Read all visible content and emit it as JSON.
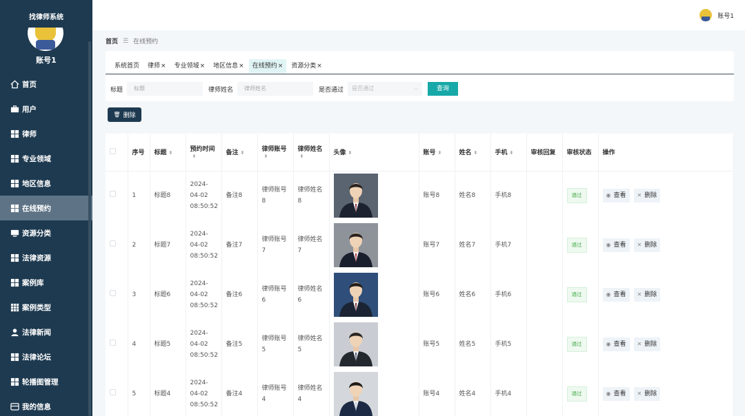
{
  "app": {
    "title": "找律师系统"
  },
  "sidebar": {
    "user": "账号1",
    "items": [
      {
        "label": "首页",
        "icon": "home-icon",
        "active": false
      },
      {
        "label": "用户",
        "icon": "briefcase-icon",
        "active": false
      },
      {
        "label": "律师",
        "icon": "grid-icon",
        "active": false
      },
      {
        "label": "专业领域",
        "icon": "grid-icon",
        "active": false
      },
      {
        "label": "地区信息",
        "icon": "grid-icon",
        "active": false
      },
      {
        "label": "在线预约",
        "icon": "grid-icon",
        "active": true
      },
      {
        "label": "资源分类",
        "icon": "monitor-icon",
        "active": false
      },
      {
        "label": "法律资源",
        "icon": "grid-icon",
        "active": false
      },
      {
        "label": "案例库",
        "icon": "grid-icon",
        "active": false
      },
      {
        "label": "案例类型",
        "icon": "table-icon",
        "active": false
      },
      {
        "label": "法律新闻",
        "icon": "user-icon",
        "active": false
      },
      {
        "label": "法律论坛",
        "icon": "grid-icon",
        "active": false
      },
      {
        "label": "轮播图管理",
        "icon": "grid-icon",
        "active": false
      },
      {
        "label": "我的信息",
        "icon": "card-icon",
        "active": false
      }
    ]
  },
  "header": {
    "user": "账号1"
  },
  "breadcrumb": {
    "home": "首页",
    "separator": "☰",
    "current": "在线预约"
  },
  "tabs": [
    {
      "label": "系统首页",
      "closable": false,
      "active": false
    },
    {
      "label": "律师",
      "closable": true,
      "active": false
    },
    {
      "label": "专业领域",
      "closable": true,
      "active": false
    },
    {
      "label": "地区信息",
      "closable": true,
      "active": false
    },
    {
      "label": "在线预约",
      "closable": true,
      "active": true
    },
    {
      "label": "资源分类",
      "closable": true,
      "active": false
    }
  ],
  "search": {
    "title_label": "标题",
    "title_placeholder": "标题",
    "lawyer_label": "律师姓名",
    "lawyer_placeholder": "律师姓名",
    "passed_label": "是否通过",
    "passed_placeholder": "是否通过",
    "query_button": "查询"
  },
  "toolbar": {
    "delete_label": "删除"
  },
  "table": {
    "columns": [
      "序号",
      "标题",
      "预约时间",
      "备注",
      "律师账号",
      "律师姓名",
      "头像",
      "账号",
      "姓名",
      "手机",
      "审核回复",
      "审核状态",
      "操作"
    ],
    "rows": [
      {
        "no": "1",
        "title": "标题8",
        "time": "2024-04-02 08:50:52",
        "note": "备注8",
        "lawyer_account": "律师账号8",
        "lawyer_name": "律师姓名8",
        "account": "账号8",
        "name": "姓名8",
        "phone": "手机8",
        "reply": "",
        "status": "通过"
      },
      {
        "no": "2",
        "title": "标题7",
        "time": "2024-04-02 08:50:52",
        "note": "备注7",
        "lawyer_account": "律师账号7",
        "lawyer_name": "律师姓名7",
        "account": "账号7",
        "name": "姓名7",
        "phone": "手机7",
        "reply": "",
        "status": "通过"
      },
      {
        "no": "3",
        "title": "标题6",
        "time": "2024-04-02 08:50:52",
        "note": "备注6",
        "lawyer_account": "律师账号6",
        "lawyer_name": "律师姓名6",
        "account": "账号6",
        "name": "姓名6",
        "phone": "手机6",
        "reply": "",
        "status": "通过"
      },
      {
        "no": "4",
        "title": "标题5",
        "time": "2024-04-02 08:50:52",
        "note": "备注5",
        "lawyer_account": "律师账号5",
        "lawyer_name": "律师姓名5",
        "account": "账号5",
        "name": "姓名5",
        "phone": "手机5",
        "reply": "",
        "status": "通过"
      },
      {
        "no": "5",
        "title": "标题4",
        "time": "2024-04-02 08:50:52",
        "note": "备注4",
        "lawyer_account": "律师账号4",
        "lawyer_name": "律师姓名4",
        "account": "账号4",
        "name": "姓名4",
        "phone": "手机4",
        "reply": "",
        "status": "通过"
      }
    ],
    "actions": {
      "view": "查看",
      "delete": "删除"
    }
  },
  "colors": {
    "sidebar_bg": "#1e3a50",
    "accent": "#17a8a8",
    "active_item": "#5e7386"
  }
}
